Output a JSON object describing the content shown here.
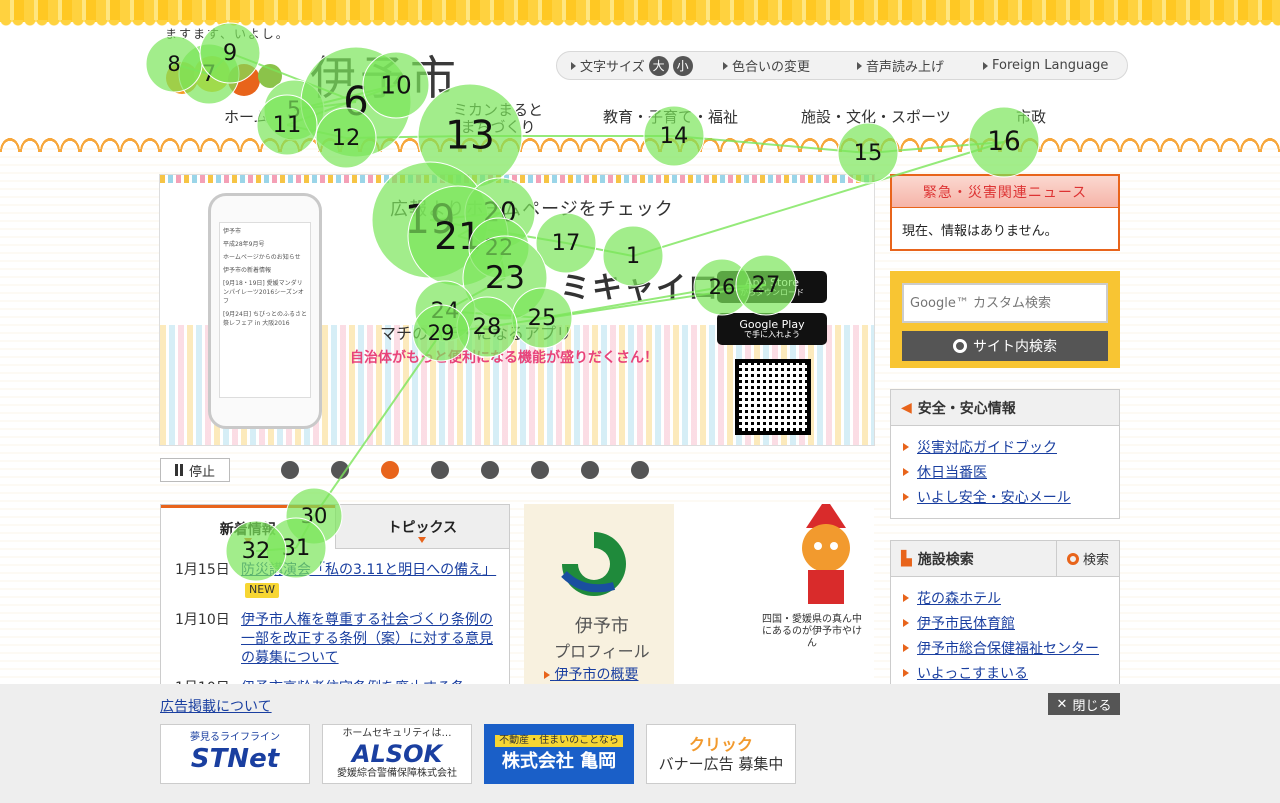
{
  "header": {
    "tagline": "ますます、いよし。",
    "site_name": "伊予市",
    "utility": {
      "font_size_label": "文字サイズ",
      "font_large": "大",
      "font_small": "小",
      "color_change": "色合いの変更",
      "voice": "音声読み上げ",
      "foreign": "Foreign Language"
    }
  },
  "nav": {
    "items": [
      {
        "label": "ホーム"
      },
      {
        "label": "ミカンまるとまちづくり"
      },
      {
        "label": "教育・子育て・福祉"
      },
      {
        "label": "施設・文化・スポーツ"
      },
      {
        "label": "市政"
      }
    ]
  },
  "banner": {
    "headline": "広報よりホームページをチェック",
    "app_name": "ミキャイロ",
    "sub1": "マチのハチ・になるアプリ",
    "sub2": "自治体がもっと便利になる機能が盛りだくさん！",
    "appstore_line1": "App Store",
    "appstore_line2": "からダウンロード",
    "googleplay_line1": "Google Play",
    "googleplay_line2": "で手に入れよう",
    "phone_lines": [
      "伊予市",
      "平成28年9月号",
      "ホームページからのお知らせ",
      "伊予市の新着情報",
      "[9月18・19日] 愛媛マンダリンパイレーツ2016シーズンオフ",
      "[9月24日] ちびっとのふるさと祭レフェア in 大阪2016"
    ]
  },
  "slider": {
    "stop_label": "停止",
    "page_count": 8,
    "active_index": 2
  },
  "news": {
    "tabs": [
      "新着情報",
      "トピックス"
    ],
    "items": [
      {
        "date": "1月15日",
        "title": "防災講演会「私の3.11と明日への備え」",
        "badge": "NEW"
      },
      {
        "date": "1月10日",
        "title": "伊予市人権を尊重する社会づくり条例の一部を改正する条例（案）に対する意見の募集について",
        "badge": ""
      },
      {
        "date": "1月10日",
        "title": "伊予市高齢者住宅条例を廃止する条",
        "badge": ""
      }
    ]
  },
  "profile": {
    "title_line1": "伊予市",
    "title_line2": "プロフィール",
    "link": "伊予市の概要",
    "bubble": "四国・愛媛県の真ん中にあるのが伊予市やけん"
  },
  "emergency": {
    "title": "緊急・災害関連ニュース",
    "body": "現在、情報はありません。"
  },
  "search": {
    "placeholder": "Google™ カスタム検索",
    "button": "サイト内検索"
  },
  "safety": {
    "title": "安全・安心情報",
    "links": [
      "災害対応ガイドブック",
      "休日当番医",
      "いよし安全・安心メール"
    ]
  },
  "facility": {
    "title": "施設検索",
    "search_button": "検索",
    "links": [
      "花の森ホテル",
      "伊予市民体育館",
      "伊予市総合保健福祉センター",
      "いよっこすまいる"
    ]
  },
  "footer": {
    "ad_link": "広告掲載について",
    "close": "閉じる",
    "ads": [
      {
        "line1": "夢見るライフライン",
        "line2": "STNet"
      },
      {
        "line1": "ホームセキュリティは…",
        "line2": "ALSOK",
        "line3": "愛媛綜合警備保障株式会社"
      },
      {
        "line1": "不動産・住まいのことなら",
        "line2": "株式会社 亀岡"
      },
      {
        "line1": "クリック",
        "line2": "バナー広告 募集中"
      }
    ]
  },
  "gaze": {
    "color": "#7be55a",
    "points": [
      {
        "n": "1"
      },
      {
        "n": "5"
      },
      {
        "n": "6"
      },
      {
        "n": "7"
      },
      {
        "n": "8"
      },
      {
        "n": "9"
      },
      {
        "n": "10"
      },
      {
        "n": "11"
      },
      {
        "n": "12"
      },
      {
        "n": "13"
      },
      {
        "n": "14"
      },
      {
        "n": "15"
      },
      {
        "n": "16"
      },
      {
        "n": "17"
      },
      {
        "n": "19"
      },
      {
        "n": "20"
      },
      {
        "n": "21"
      },
      {
        "n": "22"
      },
      {
        "n": "23"
      },
      {
        "n": "24"
      },
      {
        "n": "25"
      },
      {
        "n": "26"
      },
      {
        "n": "27"
      },
      {
        "n": "28"
      },
      {
        "n": "29"
      },
      {
        "n": "30"
      },
      {
        "n": "31"
      },
      {
        "n": "32"
      }
    ]
  }
}
